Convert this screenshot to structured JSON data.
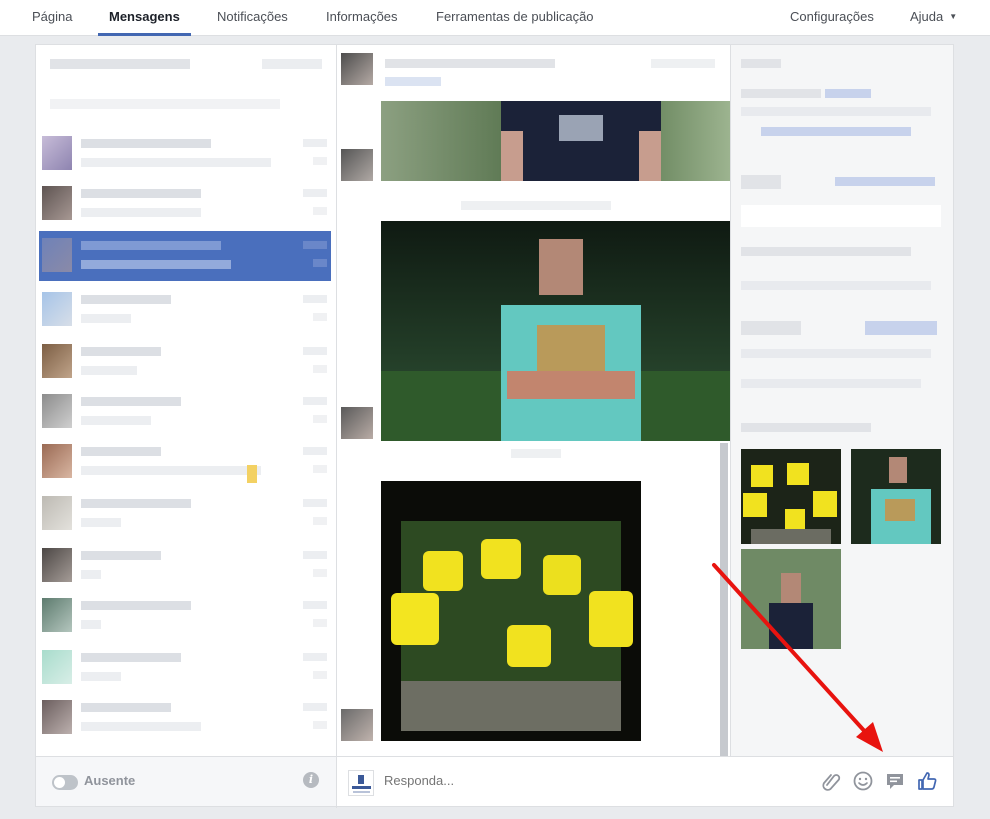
{
  "nav": {
    "tabs": [
      {
        "label": "Página"
      },
      {
        "label": "Mensagens"
      },
      {
        "label": "Notificações"
      },
      {
        "label": "Informações"
      },
      {
        "label": "Ferramentas de publicação"
      }
    ],
    "right": [
      {
        "label": "Configurações"
      },
      {
        "label": "Ajuda"
      }
    ],
    "active_tab": "Mensagens"
  },
  "sidebar": {
    "status_label": "Ausente",
    "status_on": false
  },
  "composer": {
    "placeholder": "Responda...",
    "icons": [
      "paperclip-icon",
      "smiley-icon",
      "chat-bubble-icon",
      "thumbs-up-icon"
    ]
  },
  "colors": {
    "accent": "#4267b2",
    "selected_conversation": "#4a6fbd",
    "annotation_arrow": "#e8130f"
  }
}
